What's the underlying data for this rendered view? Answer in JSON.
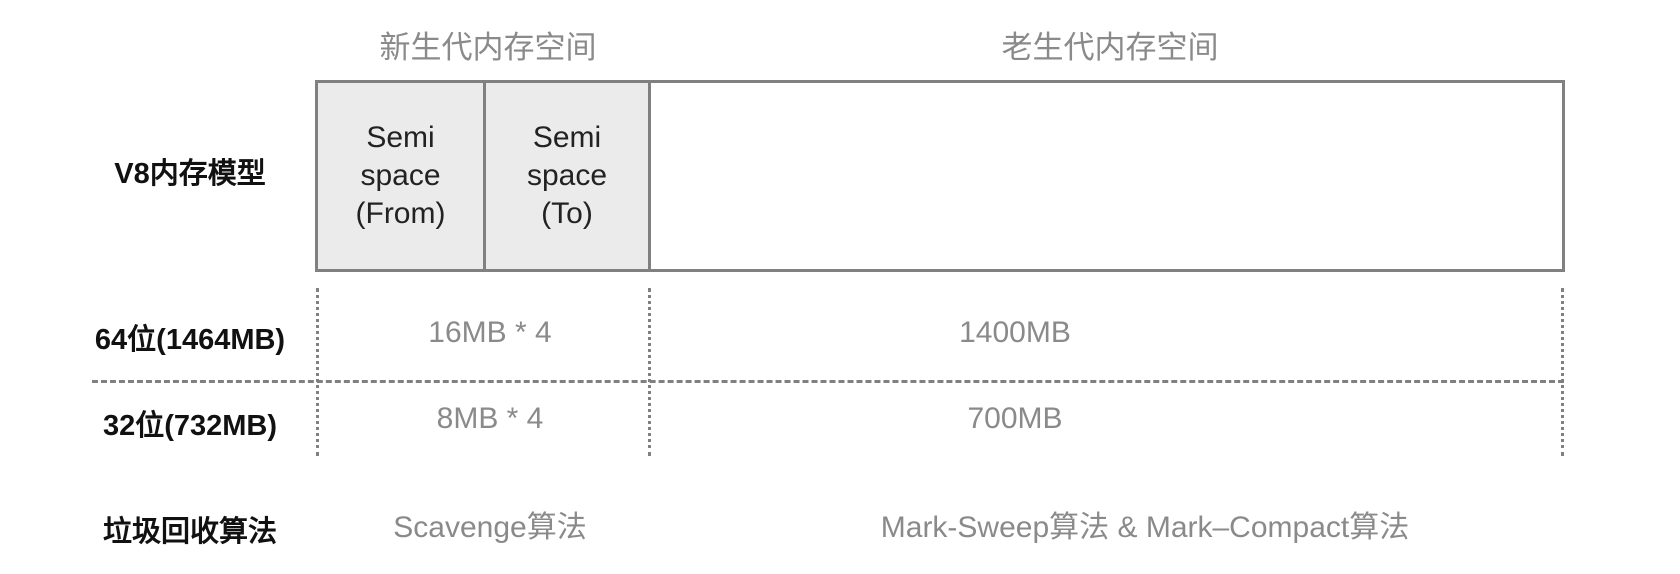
{
  "headers": {
    "young_generation": "新生代内存空间",
    "old_generation": "老生代内存空间"
  },
  "rows": {
    "model_label": "V8内存模型",
    "x64_label": "64位(1464MB)",
    "x32_label": "32位(732MB)",
    "gc_label": "垃圾回收算法"
  },
  "semispaces": [
    {
      "line1": "Semi",
      "line2": "space",
      "line3": "(From)"
    },
    {
      "line1": "Semi",
      "line2": "space",
      "line3": "(To)"
    }
  ],
  "values": {
    "x64_young": "16MB * 4",
    "x64_old": "1400MB",
    "x32_young": "8MB * 4",
    "x32_old": "700MB"
  },
  "algorithms": {
    "young": "Scavenge算法",
    "old": "Mark-Sweep算法 & Mark–Compact算法"
  },
  "colors": {
    "border": "#808080",
    "semispace_fill": "#ebebeb",
    "muted_text": "#8a8a8a",
    "label_text": "#111111"
  }
}
